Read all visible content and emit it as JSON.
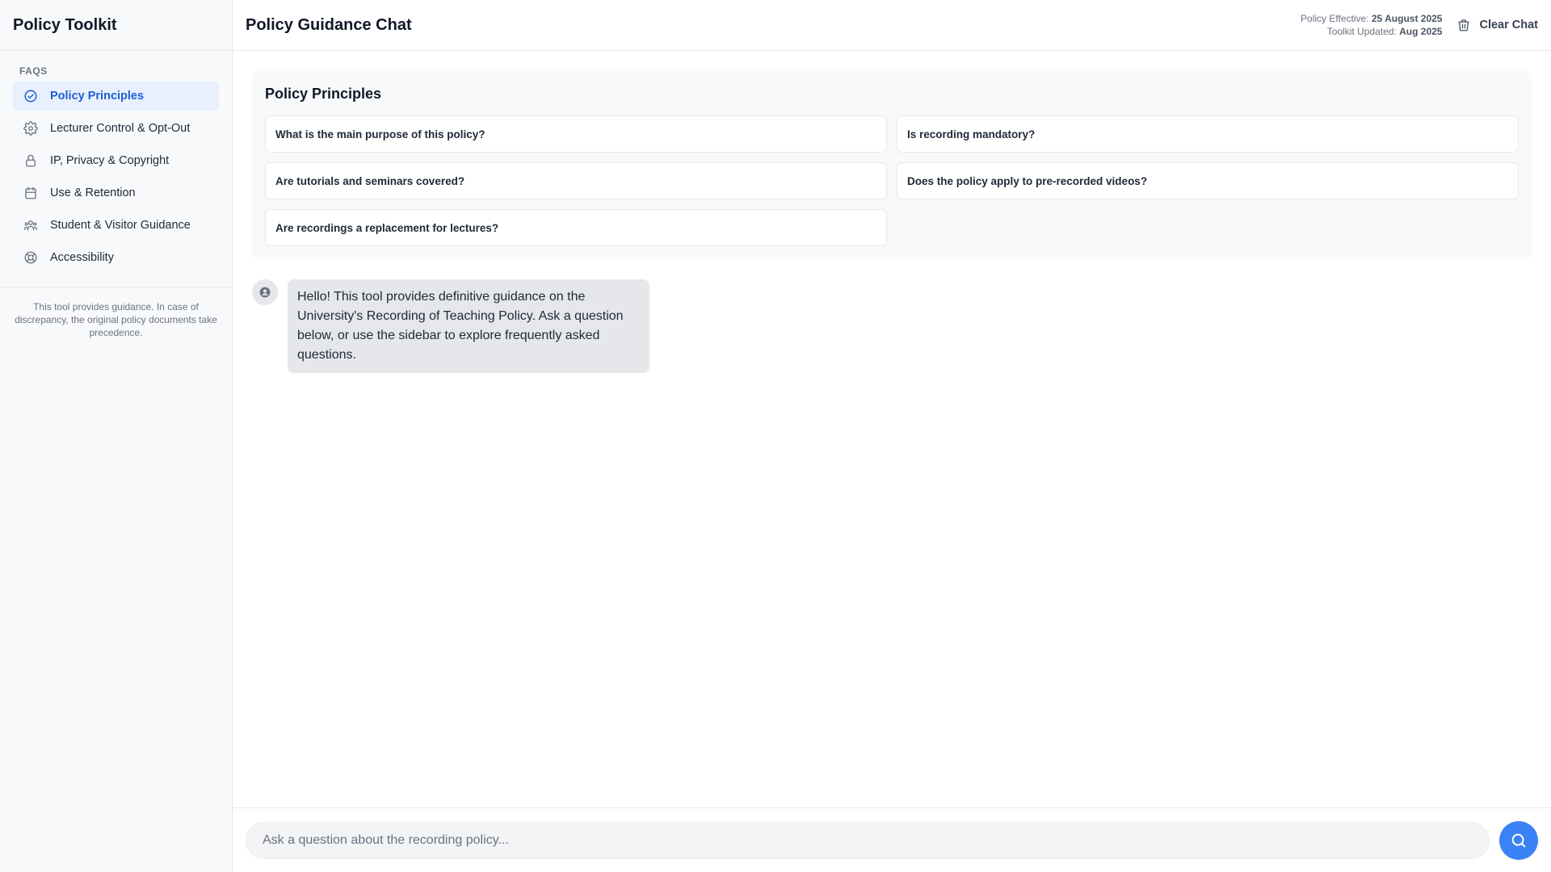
{
  "sidebar": {
    "title": "Policy Toolkit",
    "section_label": "FAQs",
    "items": [
      {
        "label": "Policy Principles",
        "icon": "check-circle-icon",
        "active": true
      },
      {
        "label": "Lecturer Control & Opt-Out",
        "icon": "gear-icon",
        "active": false
      },
      {
        "label": "IP, Privacy & Copyright",
        "icon": "lock-icon",
        "active": false
      },
      {
        "label": "Use & Retention",
        "icon": "calendar-icon",
        "active": false
      },
      {
        "label": "Student & Visitor Guidance",
        "icon": "users-icon",
        "active": false
      },
      {
        "label": "Accessibility",
        "icon": "lifebuoy-icon",
        "active": false
      }
    ],
    "footer": "This tool provides guidance. In case of discrepancy, the original policy documents take precedence."
  },
  "header": {
    "title": "Policy Guidance Chat",
    "effective_label": "Policy Effective:",
    "effective_value": "25 August 2025",
    "updated_label": "Toolkit Updated:",
    "updated_value": "Aug 2025",
    "clear_label": "Clear Chat"
  },
  "faq_card": {
    "title": "Policy Principles",
    "questions": [
      "What is the main purpose of this policy?",
      "Is recording mandatory?",
      "Are tutorials and seminars covered?",
      "Does the policy apply to pre-recorded videos?",
      "Are recordings a replacement for lectures?"
    ]
  },
  "messages": [
    {
      "role": "assistant",
      "text": "Hello! This tool provides definitive guidance on the University's Recording of Teaching Policy. Ask a question below, or use the sidebar to explore frequently asked questions."
    }
  ],
  "composer": {
    "placeholder": "Ask a question about the recording policy..."
  },
  "colors": {
    "accent": "#3b82f6",
    "active_text": "#1d5fd1",
    "active_bg": "#e8f0fe"
  }
}
